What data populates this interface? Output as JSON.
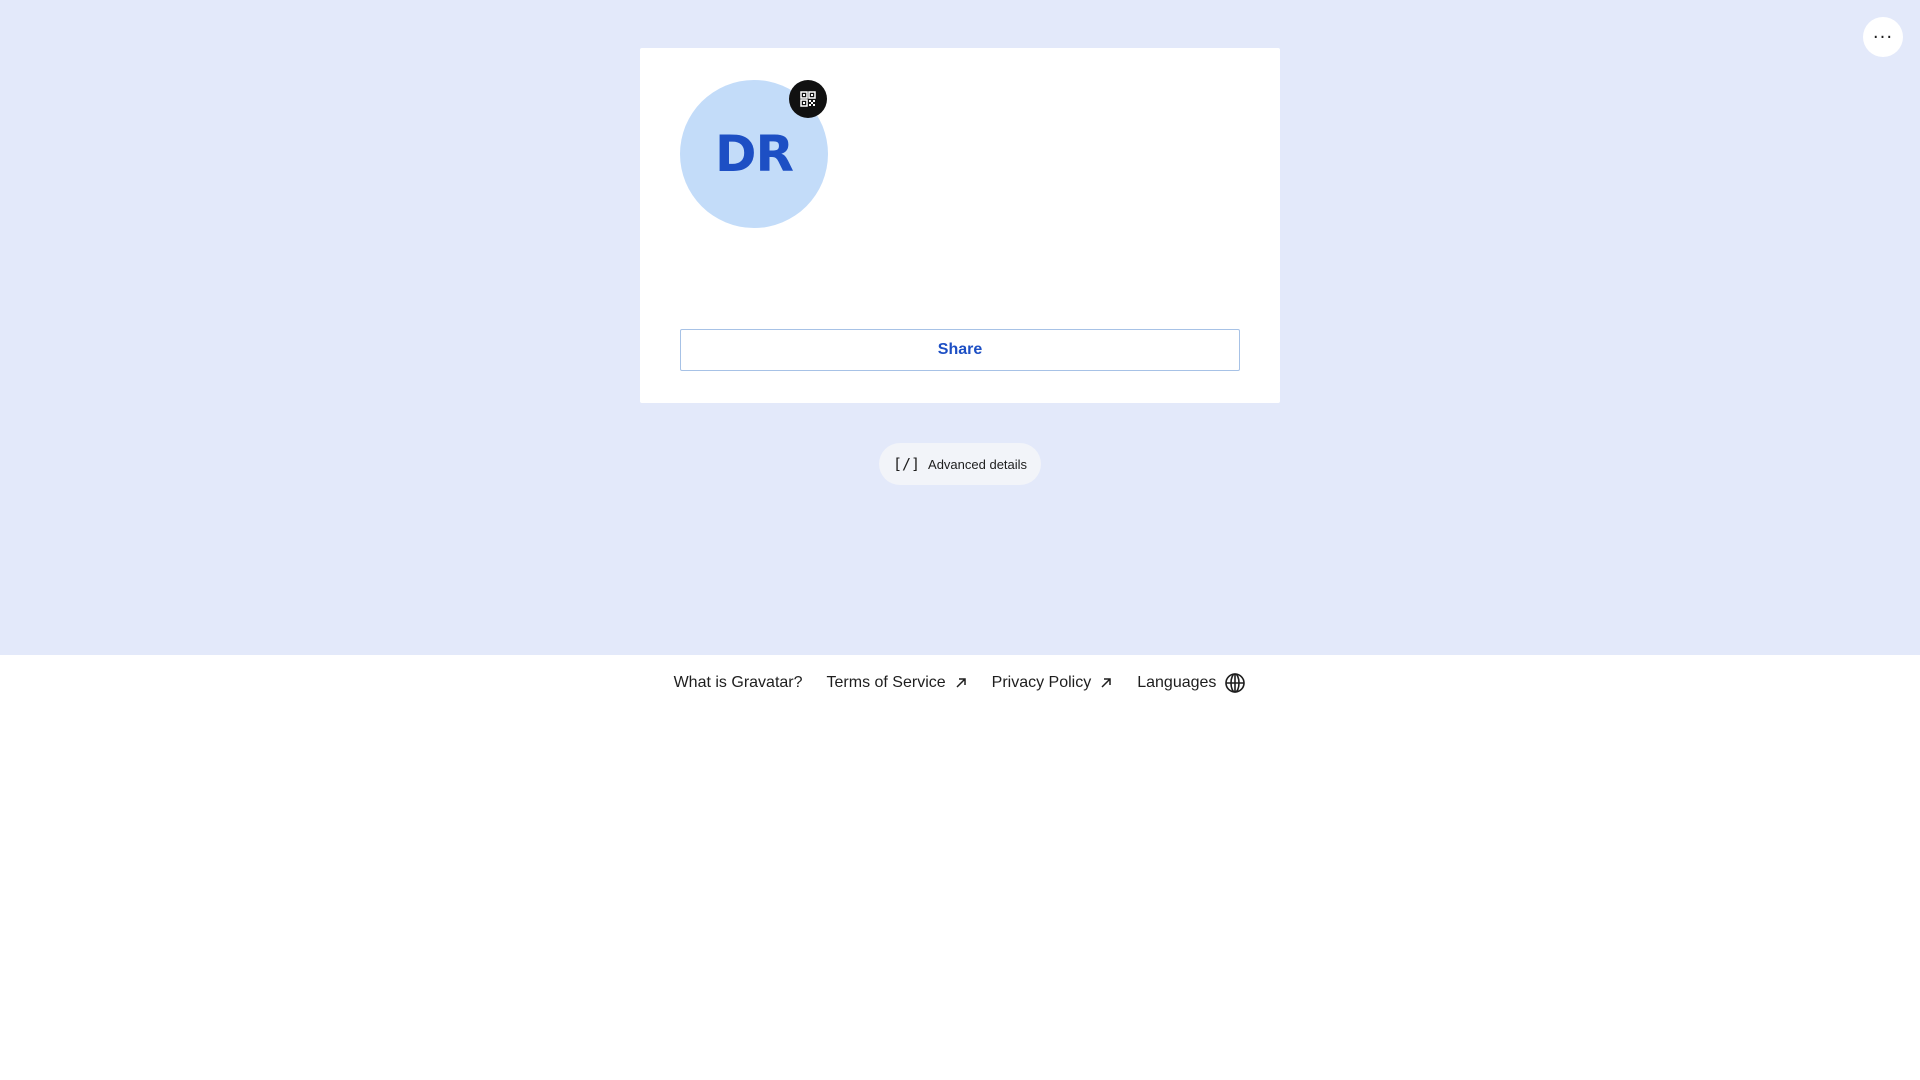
{
  "topbar": {
    "more_icon": "more-horizontal-icon",
    "more_label": "···"
  },
  "profile": {
    "initials": "DR",
    "avatar_bg": "#c3dcf9",
    "avatar_text_color": "#1d4fc4",
    "qr_icon": "qr-code-icon",
    "share_label": "Share"
  },
  "advanced": {
    "icon": "code-icon",
    "icon_text": "[/]",
    "label": "Advanced details"
  },
  "footer": {
    "links": [
      {
        "label": "What is Gravatar?"
      },
      {
        "label": "Terms of Service",
        "icon": "external-link-icon"
      },
      {
        "label": "Privacy Policy",
        "icon": "external-link-icon"
      },
      {
        "label": "Languages",
        "icon": "globe-icon"
      }
    ]
  },
  "colors": {
    "page_bg": "#e3e9fa",
    "accent": "#1d4fc4"
  }
}
